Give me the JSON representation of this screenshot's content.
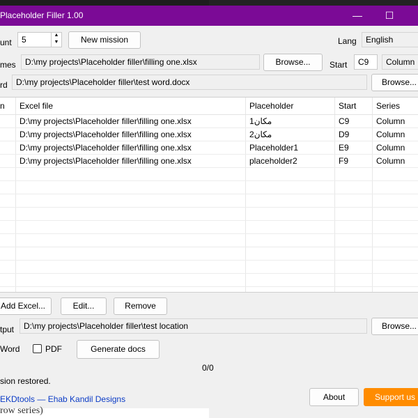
{
  "window": {
    "title": "Placeholder Filler 1.00"
  },
  "top": {
    "count_label": "unt",
    "count_value": "5",
    "new_mission": "New mission",
    "lang_label": "Lang",
    "lang_value": "English",
    "names_label": "mes",
    "names_path": "D:\\my projects\\Placeholder filler\\filling one.xlsx",
    "browse1": "Browse...",
    "start_label": "Start",
    "start_value": "C9",
    "series_value": "Column",
    "word_label": "rd",
    "word_path": "D:\\my projects\\Placeholder filler\\test word.docx",
    "browse2": "Browse..."
  },
  "grid": {
    "headers": [
      "n",
      "Excel file",
      "Placeholder",
      "Start",
      "Series"
    ],
    "rows": [
      {
        "file": "D:\\my projects\\Placeholder filler\\filling one.xlsx",
        "placeholder": "مكان1",
        "start": "C9",
        "series": "Column"
      },
      {
        "file": "D:\\my projects\\Placeholder filler\\filling one.xlsx",
        "placeholder": "مكان2",
        "start": "D9",
        "series": "Column"
      },
      {
        "file": "D:\\my projects\\Placeholder filler\\filling one.xlsx",
        "placeholder": "Placeholder1",
        "start": "E9",
        "series": "Column"
      },
      {
        "file": "D:\\my projects\\Placeholder filler\\filling one.xlsx",
        "placeholder": "placeholder2",
        "start": "F9",
        "series": "Column"
      }
    ]
  },
  "actions": {
    "add_excel": "Add Excel...",
    "edit": "Edit...",
    "remove": "Remove"
  },
  "output": {
    "label": "tput",
    "path": "D:\\my projects\\Placeholder filler\\test location",
    "browse": "Browse...",
    "word_label": "Word",
    "pdf_label": "PDF",
    "generate": "Generate docs",
    "progress": "0/0"
  },
  "status": {
    "message": "sion restored."
  },
  "footer": {
    "credit": "EKDtools — Ehab Kandil Designs",
    "about": "About",
    "support": "Support us",
    "behind_text": "row series)"
  },
  "colors": {
    "titlebar": "#7b0a96",
    "accent": "#ff8c00",
    "link": "#0c3cc6"
  }
}
